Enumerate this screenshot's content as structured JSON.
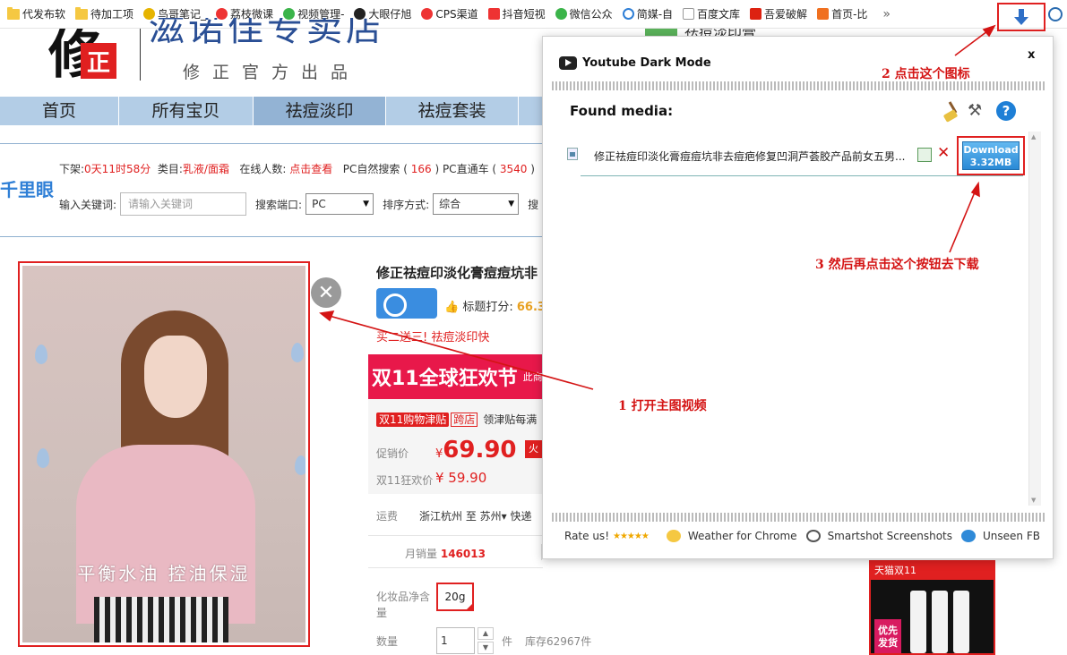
{
  "bookmarks": [
    {
      "label": "代发布软",
      "icon": "folder-icon"
    },
    {
      "label": "待加工项",
      "icon": "folder-icon"
    },
    {
      "label": "鸟哥笔记_",
      "icon": "bird-icon"
    },
    {
      "label": "荔枝微课",
      "icon": "lychee-icon"
    },
    {
      "label": "视频管理-",
      "icon": "video-icon"
    },
    {
      "label": "大眼仔旭",
      "icon": "eye-icon"
    },
    {
      "label": "CPS渠道",
      "icon": "cps-icon"
    },
    {
      "label": "抖音短视",
      "icon": "download-icon"
    },
    {
      "label": "微信公众",
      "icon": "wechat-icon"
    },
    {
      "label": "简媒-自",
      "icon": "jianmei-icon"
    },
    {
      "label": "百度文库",
      "icon": "page-icon"
    },
    {
      "label": "吾爱破解",
      "icon": "52pojie-icon"
    },
    {
      "label": "首页-比",
      "icon": "bi-icon"
    }
  ],
  "bookmarks_more": "»",
  "store": {
    "logo_char": "修",
    "logo_seal": "正",
    "name": "滋诺佳专卖店",
    "subtitle": "修正官方出品",
    "top_right_text": "祛痘淡印膏"
  },
  "nav": [
    "首页",
    "所有宝贝",
    "祛痘淡印",
    "祛痘套装"
  ],
  "qianliyan": {
    "logo": "千里眼",
    "row1": [
      {
        "label": "下架:",
        "value": "0天11时58分"
      },
      {
        "label": "类目:",
        "value": "乳液/面霜"
      },
      {
        "label": "在线人数:",
        "value": "点击查看"
      },
      {
        "label": "PC自然搜索 (",
        "value": "166"
      },
      {
        "label": ") PC直通车 (",
        "value": "3540"
      },
      {
        "label": ")",
        "value": ""
      }
    ],
    "keyword_label": "输入关键词:",
    "keyword_placeholder": "请输入关键词",
    "port_label": "搜索端口:",
    "port_value": "PC",
    "sort_label": "排序方式:",
    "sort_value": "综合",
    "extra_label": "搜"
  },
  "video": {
    "caption": "平衡水油 控油保湿",
    "close_glyph": "✕"
  },
  "product": {
    "title": "修正祛痘印淡化膏痘痘坑非",
    "score_label": "标题打分:",
    "score_value": "66.3",
    "promo": "买二送三! 祛痘淡印快",
    "banner": "双11全球狂欢节",
    "banner_small": "此商",
    "jintie_tag": "双11购物津贴",
    "jintie_tag2": "跨店",
    "jintie_rest": "领津贴每满",
    "price_label": "促销价",
    "currency": "¥",
    "price": "69.90",
    "hot_tag": "火",
    "d11_label": "双11狂欢价",
    "d11_price": "¥ 59.90",
    "ship_label": "运费",
    "ship_from": "浙江杭州",
    "ship_to": "至 苏州▾",
    "ship_extra": "快递",
    "sales_label": "月销量",
    "sales_value": "146013",
    "size_label": "化妆品净含量",
    "size_value": "20g",
    "qty_label": "数量",
    "qty_value": "1",
    "unit": "件",
    "stock": "库存62967件"
  },
  "ad": {
    "top": "天猫双11",
    "tag": "优先发货"
  },
  "popup": {
    "title": "Youtube Dark Mode",
    "close": "x",
    "found_label": "Found media:",
    "help": "?",
    "media": {
      "title": "修正祛痘印淡化膏痘痘坑非去痘疤修复凹洞芦荟胶产品前女五男...",
      "download_label": "Download",
      "size": "3.32MB"
    },
    "footer": [
      {
        "label": "Rate us!",
        "icon": "stars-icon"
      },
      {
        "label": "Weather for Chrome",
        "icon": "weather-icon"
      },
      {
        "label": "Smartshot Screenshots",
        "icon": "camera-icon"
      },
      {
        "label": "Unseen FB",
        "icon": "eye-icon"
      }
    ]
  },
  "annotations": {
    "step1": "1 打开主图视频",
    "step2": "2 点击这个图标",
    "step3": "3 然后再点击这个按钮去下载"
  },
  "colors": {
    "accent_red": "#e02020",
    "nav_bg": "#b3cde6",
    "store_blue": "#2a4f95",
    "download_blue": "#2a8ad6"
  }
}
